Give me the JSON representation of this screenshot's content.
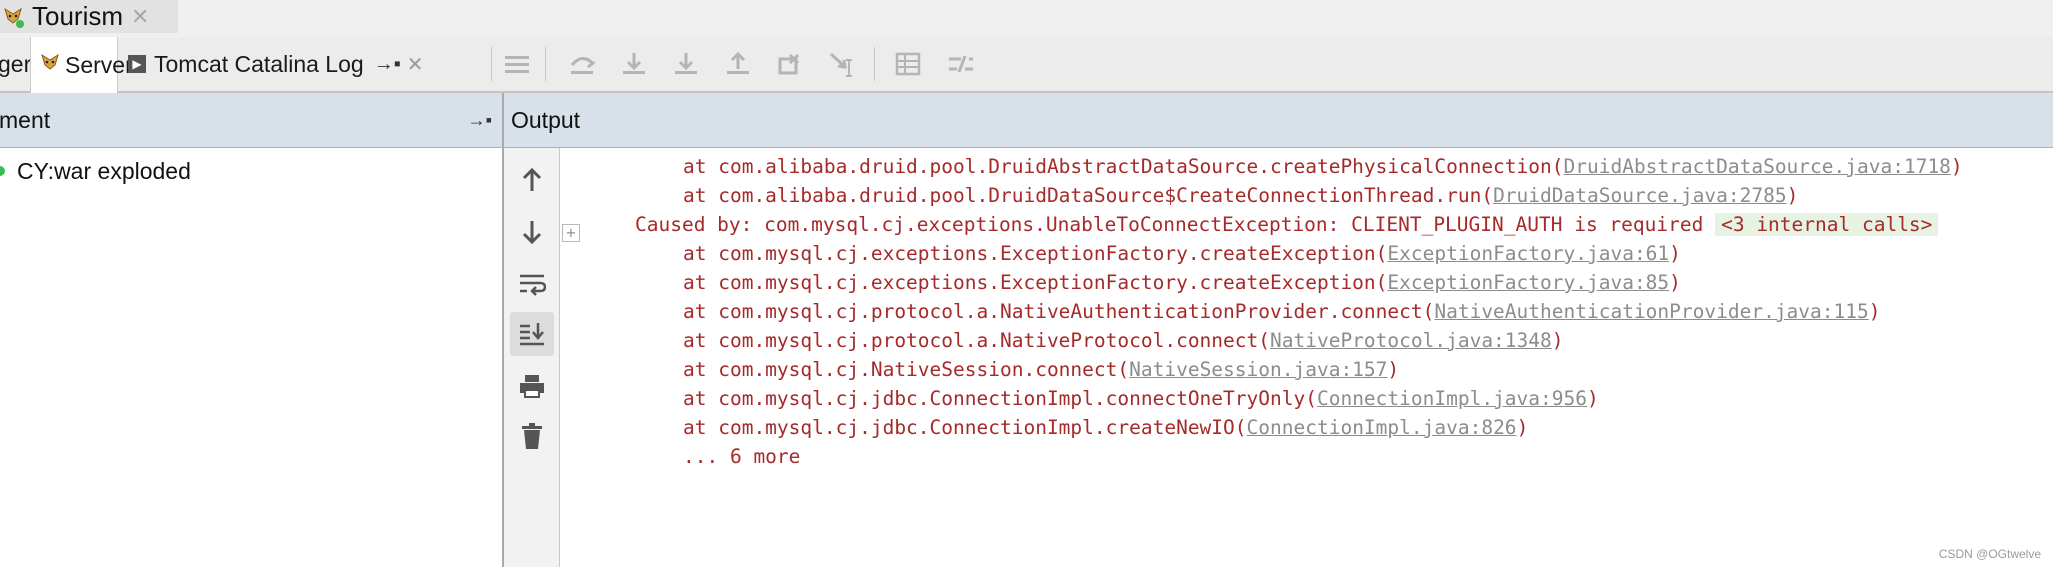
{
  "run_tab": {
    "label": "Tourism"
  },
  "tool_tabs": {
    "partial": "ger",
    "server": "Server",
    "catalina": "Tomcat Catalina Log"
  },
  "left_header": {
    "title": "ment"
  },
  "left_item": {
    "label": "CY:war exploded"
  },
  "right_header": {
    "title": "Output"
  },
  "console": {
    "lines": [
      {
        "prefix": "at com.alibaba.druid.pool.DruidAbstractDataSource.createPhysicalConnection(",
        "link": "DruidAbstractDataSource.java:1718",
        "suffix": ")"
      },
      {
        "prefix": "at com.alibaba.druid.pool.DruidDataSource$CreateConnectionThread.run(",
        "link": "DruidDataSource.java:2785",
        "suffix": ")"
      },
      {
        "prefix": "Caused by: com.mysql.cj.exceptions.UnableToConnectException: CLIENT_PLUGIN_AUTH is required ",
        "calls": "<3 internal calls>"
      },
      {
        "prefix": "at com.mysql.cj.exceptions.ExceptionFactory.createException(",
        "link": "ExceptionFactory.java:61",
        "suffix": ")"
      },
      {
        "prefix": "at com.mysql.cj.exceptions.ExceptionFactory.createException(",
        "link": "ExceptionFactory.java:85",
        "suffix": ")"
      },
      {
        "prefix": "at com.mysql.cj.protocol.a.NativeAuthenticationProvider.connect(",
        "link": "NativeAuthenticationProvider.java:115",
        "suffix": ")"
      },
      {
        "prefix": "at com.mysql.cj.protocol.a.NativeProtocol.connect(",
        "link": "NativeProtocol.java:1348",
        "suffix": ")"
      },
      {
        "prefix": "at com.mysql.cj.NativeSession.connect(",
        "link": "NativeSession.java:157",
        "suffix": ")"
      },
      {
        "prefix": "at com.mysql.cj.jdbc.ConnectionImpl.connectOneTryOnly(",
        "link": "ConnectionImpl.java:956",
        "suffix": ")"
      },
      {
        "prefix": "at com.mysql.cj.jdbc.ConnectionImpl.createNewIO(",
        "link": "ConnectionImpl.java:826",
        "suffix": ")"
      },
      {
        "prefix": "... 6 more"
      }
    ]
  },
  "watermark": "CSDN @OGtwelve",
  "colors": {
    "error_text": "#a52a2a",
    "link": "#8c8c8c",
    "header_bg": "#d8e0ea",
    "calls_bg": "#e6f2e2"
  }
}
